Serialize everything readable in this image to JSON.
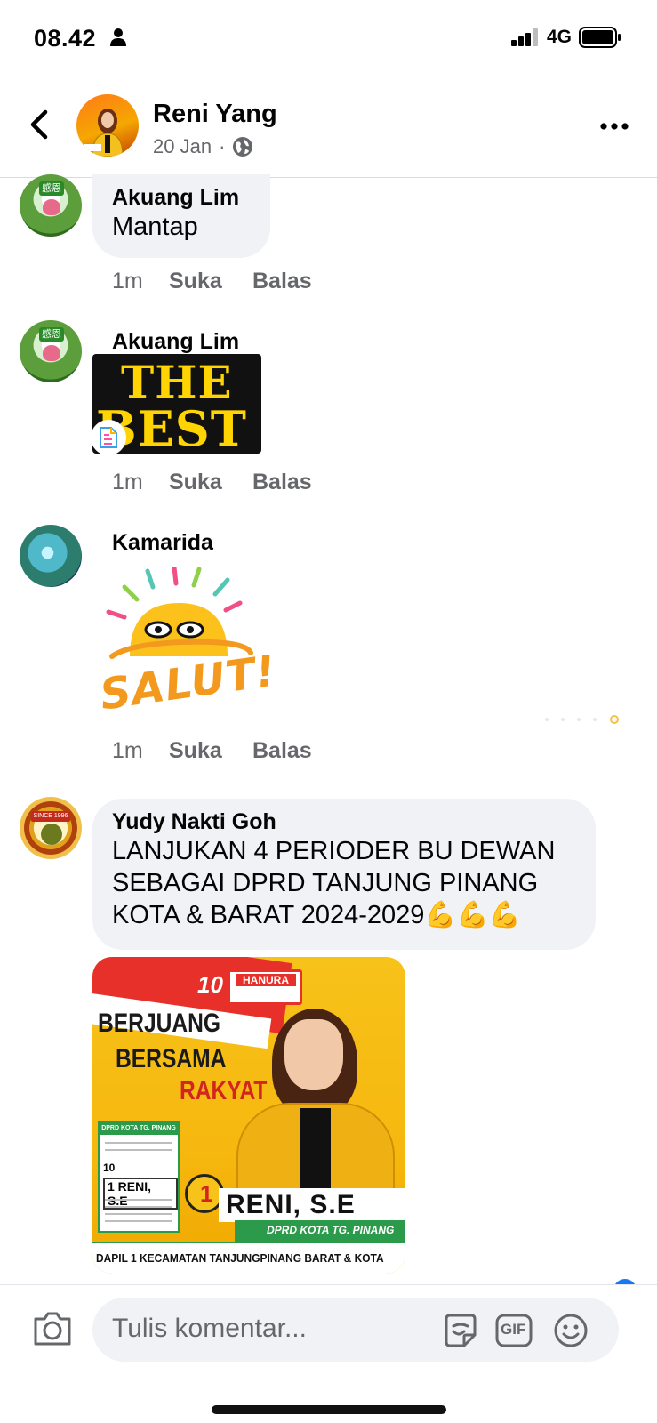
{
  "status_bar": {
    "time": "08.42",
    "network": "4G"
  },
  "header": {
    "name": "Reni Yang",
    "date": "20 Jan",
    "separator": "·"
  },
  "comments": [
    {
      "author": "Akuang Lim",
      "text": "Mantap",
      "time": "1m",
      "like_label": "Suka",
      "reply_label": "Balas",
      "avatar_tag": "感恩"
    },
    {
      "author": "Akuang Lim",
      "sticker_line1": "THE",
      "sticker_line2": "BEST",
      "time": "1m",
      "like_label": "Suka",
      "reply_label": "Balas",
      "avatar_tag": "感恩"
    },
    {
      "author": "Kamarida",
      "sticker_text": "SALUT!",
      "time": "1m",
      "like_label": "Suka",
      "reply_label": "Balas"
    },
    {
      "author": "Yudy Nakti Goh",
      "text_lines": [
        "LANJUKAN 4 PERIODER BU DEWAN",
        "SEBAGAI DPRD TANJUNG PINANG",
        "KOTA & BARAT 2024-2029💪💪💪"
      ],
      "avatar_tag": "SINCE 1996",
      "poster": {
        "number": "10",
        "party": "HANURA",
        "slogan_line1": "BERJUANG",
        "slogan_line2": "BERSAMA",
        "slogan_line3": "RAKYAT",
        "ballot_header": "DPRD KOTA TG. PINANG",
        "ballot_number": "10",
        "ballot_candidate": "1 RENI, S.E",
        "coblos_number": "1",
        "candidate_name": "RENI, S.E",
        "office": "DPRD KOTA TG. PINANG",
        "district": "DAPIL 1 KECAMATAN TANJUNGPINANG BARAT & KOTA"
      }
    }
  ],
  "composer": {
    "placeholder": "Tulis komentar...",
    "gif_label": "GIF"
  },
  "colors": {
    "bubble": "#f0f2f5",
    "secondary_text": "#65676b",
    "accent": "#1877f2"
  }
}
